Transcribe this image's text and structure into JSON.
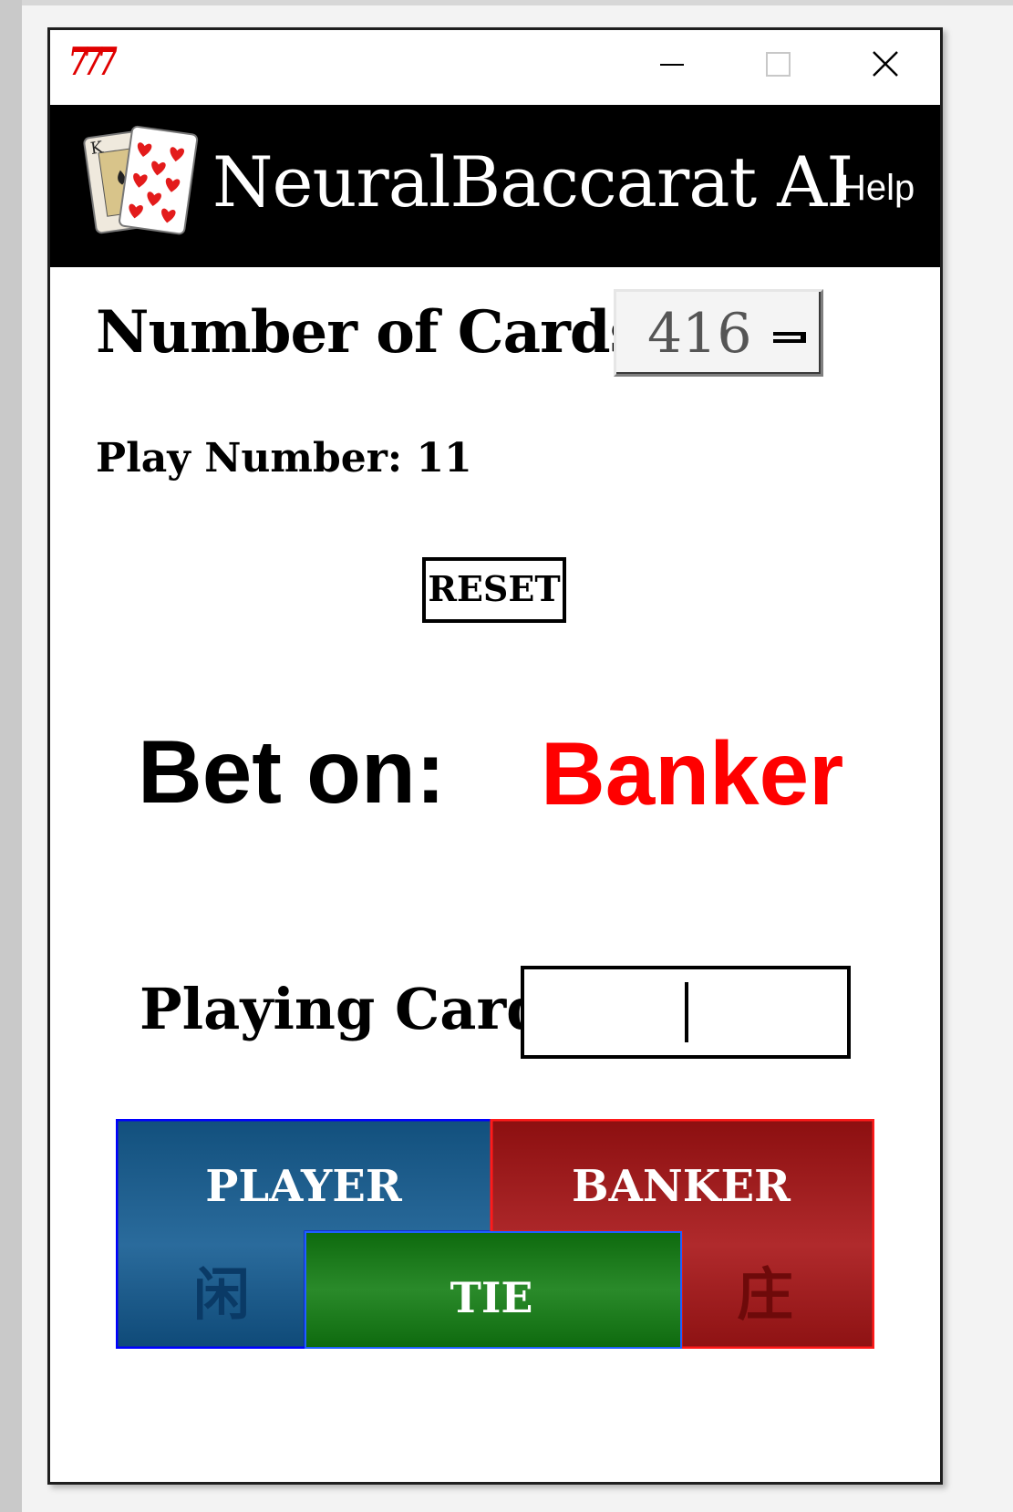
{
  "window": {
    "title_icon_text": "777",
    "controls": {
      "minimize": "minimize",
      "maximize": "maximize",
      "close": "close"
    }
  },
  "header": {
    "app_title": "NeuralBaccarat AI",
    "help_label": "Help",
    "logo_icon": "playing-cards-icon"
  },
  "settings": {
    "number_of_cards_label": "Number of Cards",
    "number_of_cards_value": "416"
  },
  "status": {
    "play_number_text": "Play Number: 11"
  },
  "actions": {
    "reset_label": "RESET"
  },
  "prediction": {
    "bet_on_label": "Bet on:",
    "bet_on_value": "Banker",
    "bet_on_color": "#ff0000"
  },
  "input": {
    "playing_cards_label": "Playing Cards",
    "playing_cards_value": ""
  },
  "table": {
    "player": {
      "label": "PLAYER",
      "chinese": "闲",
      "color": "#1f5d8f"
    },
    "banker": {
      "label": "BANKER",
      "chinese": "庄",
      "color": "#a01c1c"
    },
    "tie": {
      "label": "TIE",
      "color": "#137a13"
    }
  }
}
